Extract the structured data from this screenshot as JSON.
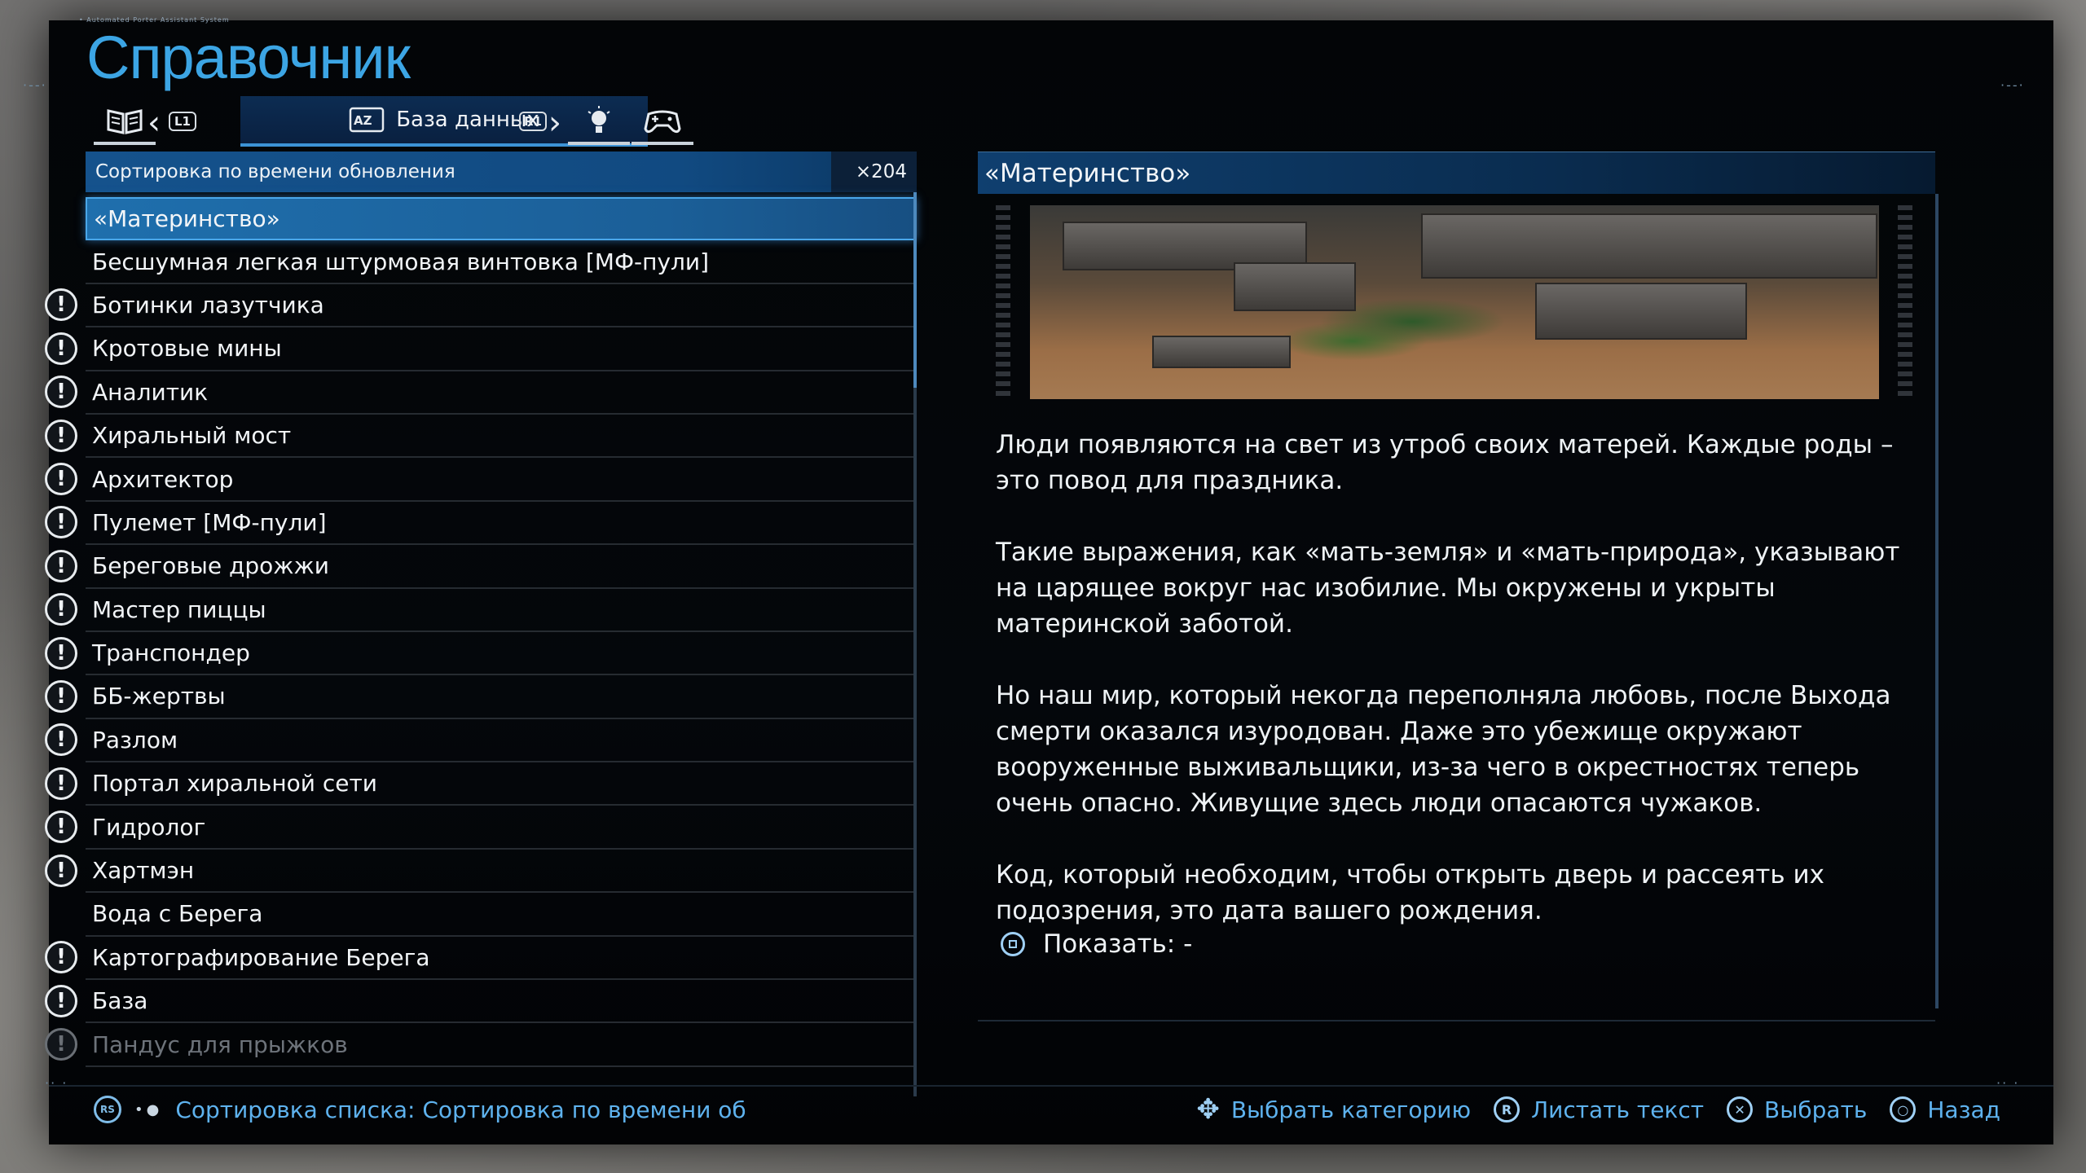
{
  "caption": "• Automated Porter Assistant System",
  "title": "Справочник",
  "tabs": {
    "prev_button": "L1",
    "next_button": "R1",
    "active_label": "База данных",
    "active_icon": "az-sort-icon"
  },
  "sort": {
    "label": "Сортировка по времени обновления",
    "count": "×204"
  },
  "list": {
    "items": [
      {
        "label": "«Материнство»",
        "alert": false,
        "selected": true
      },
      {
        "label": "Бесшумная легкая штурмовая винтовка [МФ-пули]",
        "alert": false
      },
      {
        "label": "Ботинки лазутчика",
        "alert": true
      },
      {
        "label": "Кротовые мины",
        "alert": true
      },
      {
        "label": "Аналитик",
        "alert": true
      },
      {
        "label": "Хиральный мост",
        "alert": true
      },
      {
        "label": "Архитектор",
        "alert": true
      },
      {
        "label": "Пулемет [МФ-пули]",
        "alert": true
      },
      {
        "label": "Береговые дрожжи",
        "alert": true
      },
      {
        "label": "Мастер пиццы",
        "alert": true
      },
      {
        "label": "Транспондер",
        "alert": true
      },
      {
        "label": "ББ-жертвы",
        "alert": true
      },
      {
        "label": "Разлом",
        "alert": true
      },
      {
        "label": "Портал хиральной сети",
        "alert": true
      },
      {
        "label": "Гидролог",
        "alert": true
      },
      {
        "label": "Хартмэн",
        "alert": true
      },
      {
        "label": "Вода с Берега",
        "alert": false
      },
      {
        "label": "Картографирование Берега",
        "alert": true
      },
      {
        "label": "База",
        "alert": true
      },
      {
        "label": "Пандус для прыжков",
        "alert": true,
        "faded": true
      }
    ]
  },
  "detail": {
    "title": "«Материнство»",
    "paragraphs": [
      "Люди появляются на свет из утроб своих матерей. Каждые роды – это повод для праздника.",
      "Такие выражения, как «мать-земля» и «мать-природа», указывают на царящее вокруг нас изобилие. Мы окружены и укрыты материнской заботой.",
      "Но наш мир, который некогда переполняла любовь, после Выхода смерти оказался изуродован. Даже это убежище окружают вооруженные выживальщики, из-за чего в окрестностях теперь очень опасно. Живущие здесь люди опасаются чужаков.",
      "Код, который необходим, чтобы открыть дверь и рассеять их подозрения, это дата вашего рождения."
    ],
    "show_label": "Показать: -"
  },
  "footer": {
    "left_button": "RS",
    "left_text": "Сортировка списка: Сортировка по времени об",
    "hints": {
      "category": "Выбрать категорию",
      "scroll": "Листать текст",
      "scroll_button": "R",
      "select": "Выбрать",
      "back": "Назад"
    }
  },
  "colors": {
    "accent": "#3ca5e4",
    "selection": "#1f6fad",
    "hint_text": "#5eb2ee"
  }
}
